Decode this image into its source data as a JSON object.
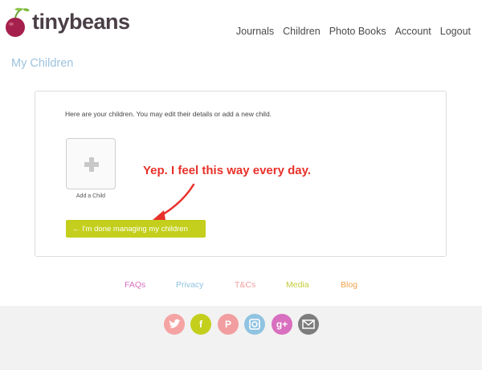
{
  "brand": {
    "name": "tinybeans"
  },
  "nav": {
    "items": [
      "Journals",
      "Children",
      "Photo Books",
      "Account",
      "Logout"
    ]
  },
  "page": {
    "title": "My Children"
  },
  "card": {
    "intro": "Here are your children. You may edit their details or add a new child.",
    "add_child_label": "Add a Child",
    "done_button_label": "← I'm done managing my children"
  },
  "annotation": {
    "text": "Yep. I feel this way every day."
  },
  "footer": {
    "links": [
      {
        "label": "FAQs",
        "color": "#d86fbf"
      },
      {
        "label": "Privacy",
        "color": "#8fc3e0"
      },
      {
        "label": "T&Cs",
        "color": "#f29e9e"
      },
      {
        "label": "Media",
        "color": "#c4cb38"
      },
      {
        "label": "Blog",
        "color": "#f0a24a"
      }
    ],
    "social": [
      {
        "icon": "twitter-icon",
        "color": "#f5a3a3"
      },
      {
        "icon": "facebook-icon",
        "color": "#c3cf1c"
      },
      {
        "icon": "pinterest-icon",
        "color": "#f29ea0"
      },
      {
        "icon": "instagram-icon",
        "color": "#8fc3e0"
      },
      {
        "icon": "google-plus-icon",
        "color": "#d86fbf"
      },
      {
        "icon": "email-icon",
        "color": "#7d7d7d"
      }
    ]
  },
  "colors": {
    "accent": "#c3cf1c",
    "title": "#9cc3dd",
    "annotation": "#e8312a"
  }
}
